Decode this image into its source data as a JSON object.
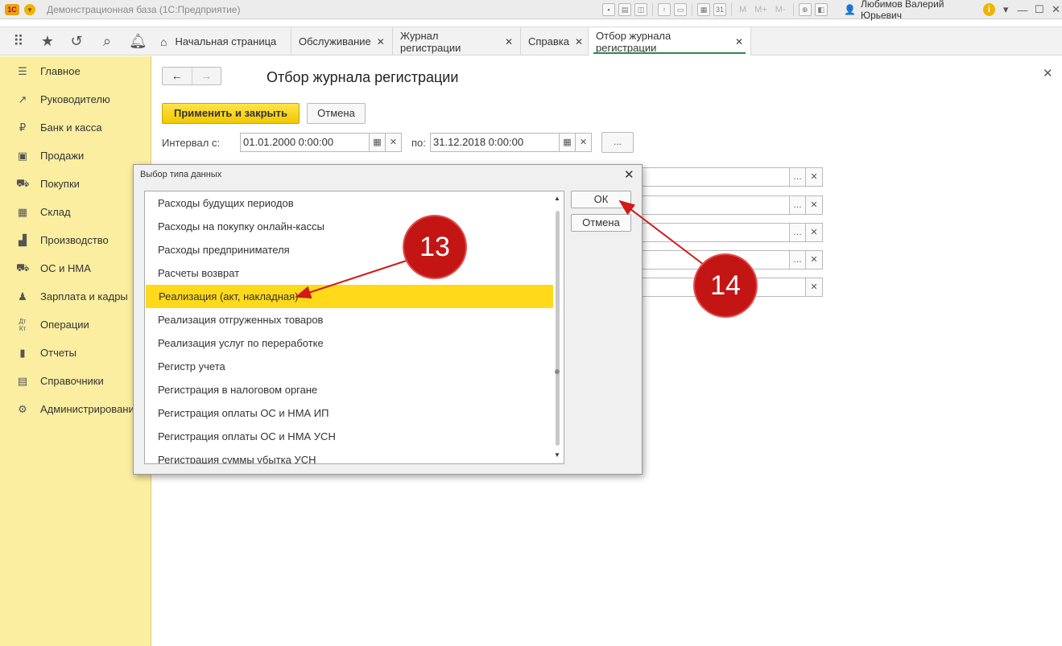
{
  "app": {
    "logo": "1С",
    "title": "Демонстрационная база (1С:Предприятие)",
    "toolbar_icons": [
      "save-icon",
      "print-icon",
      "preview-icon",
      "upload-icon",
      "document-icon",
      "calculator-icon",
      "calendar-icon"
    ],
    "toolbar_m": [
      "M",
      "M+",
      "M-"
    ],
    "user_name": "Любимов Валерий Юрьевич",
    "info_glyph": "i"
  },
  "nav": {
    "tabs": [
      {
        "label": "Начальная страница",
        "closable": false,
        "active": false
      },
      {
        "label": "Обслуживание",
        "closable": true,
        "active": false
      },
      {
        "label": "Журнал регистрации",
        "closable": true,
        "active": false
      },
      {
        "label": "Справка",
        "closable": true,
        "active": false
      },
      {
        "label": "Отбор журнала регистрации",
        "closable": true,
        "active": true
      }
    ]
  },
  "sidebar": {
    "items": [
      {
        "label": "Главное",
        "icon": "menu-icon"
      },
      {
        "label": "Руководителю",
        "icon": "trend-icon"
      },
      {
        "label": "Банк и касса",
        "icon": "ruble-icon"
      },
      {
        "label": "Продажи",
        "icon": "bag-icon"
      },
      {
        "label": "Покупки",
        "icon": "cart-icon"
      },
      {
        "label": "Склад",
        "icon": "warehouse-icon"
      },
      {
        "label": "Производство",
        "icon": "factory-icon"
      },
      {
        "label": "ОС и НМА",
        "icon": "truck-icon"
      },
      {
        "label": "Зарплата и кадры",
        "icon": "person-icon"
      },
      {
        "label": "Операции",
        "icon": "dt-kt-icon"
      },
      {
        "label": "Отчеты",
        "icon": "bar-chart-icon"
      },
      {
        "label": "Справочники",
        "icon": "book-icon"
      },
      {
        "label": "Администрирование",
        "icon": "gear-icon"
      }
    ]
  },
  "form": {
    "title": "Отбор журнала регистрации",
    "apply_label": "Применить и закрыть",
    "cancel_label": "Отмена",
    "interval_label": "Интервал с:",
    "date_from": "01.01.2000  0:00:00",
    "to_label": "по:",
    "date_to": "31.12.2018  0:00:00",
    "dots": "..."
  },
  "dialog": {
    "title": "Выбор типа данных",
    "ok_label": "ОК",
    "cancel_label": "Отмена",
    "items": [
      "Расходы будущих периодов",
      "Расходы на покупку онлайн-кассы",
      "Расходы предпринимателя",
      "Расчеты возврат",
      "Реализация (акт, накладная)",
      "Реализация отгруженных товаров",
      "Реализация услуг по переработке",
      "Регистр учета",
      "Регистрация в налоговом органе",
      "Регистрация оплаты ОС и НМА ИП",
      "Регистрация оплаты ОС и НМА УСН",
      "Регистрация суммы убытка УСН"
    ],
    "selected_index": 4
  },
  "annotations": {
    "badge_13": "13",
    "badge_14": "14"
  },
  "colors": {
    "sidebar_bg": "#fbeea0",
    "accent_yellow": "#ffd91a",
    "badge_red": "#c41515",
    "active_tab_underline": "#2a8a4a"
  }
}
